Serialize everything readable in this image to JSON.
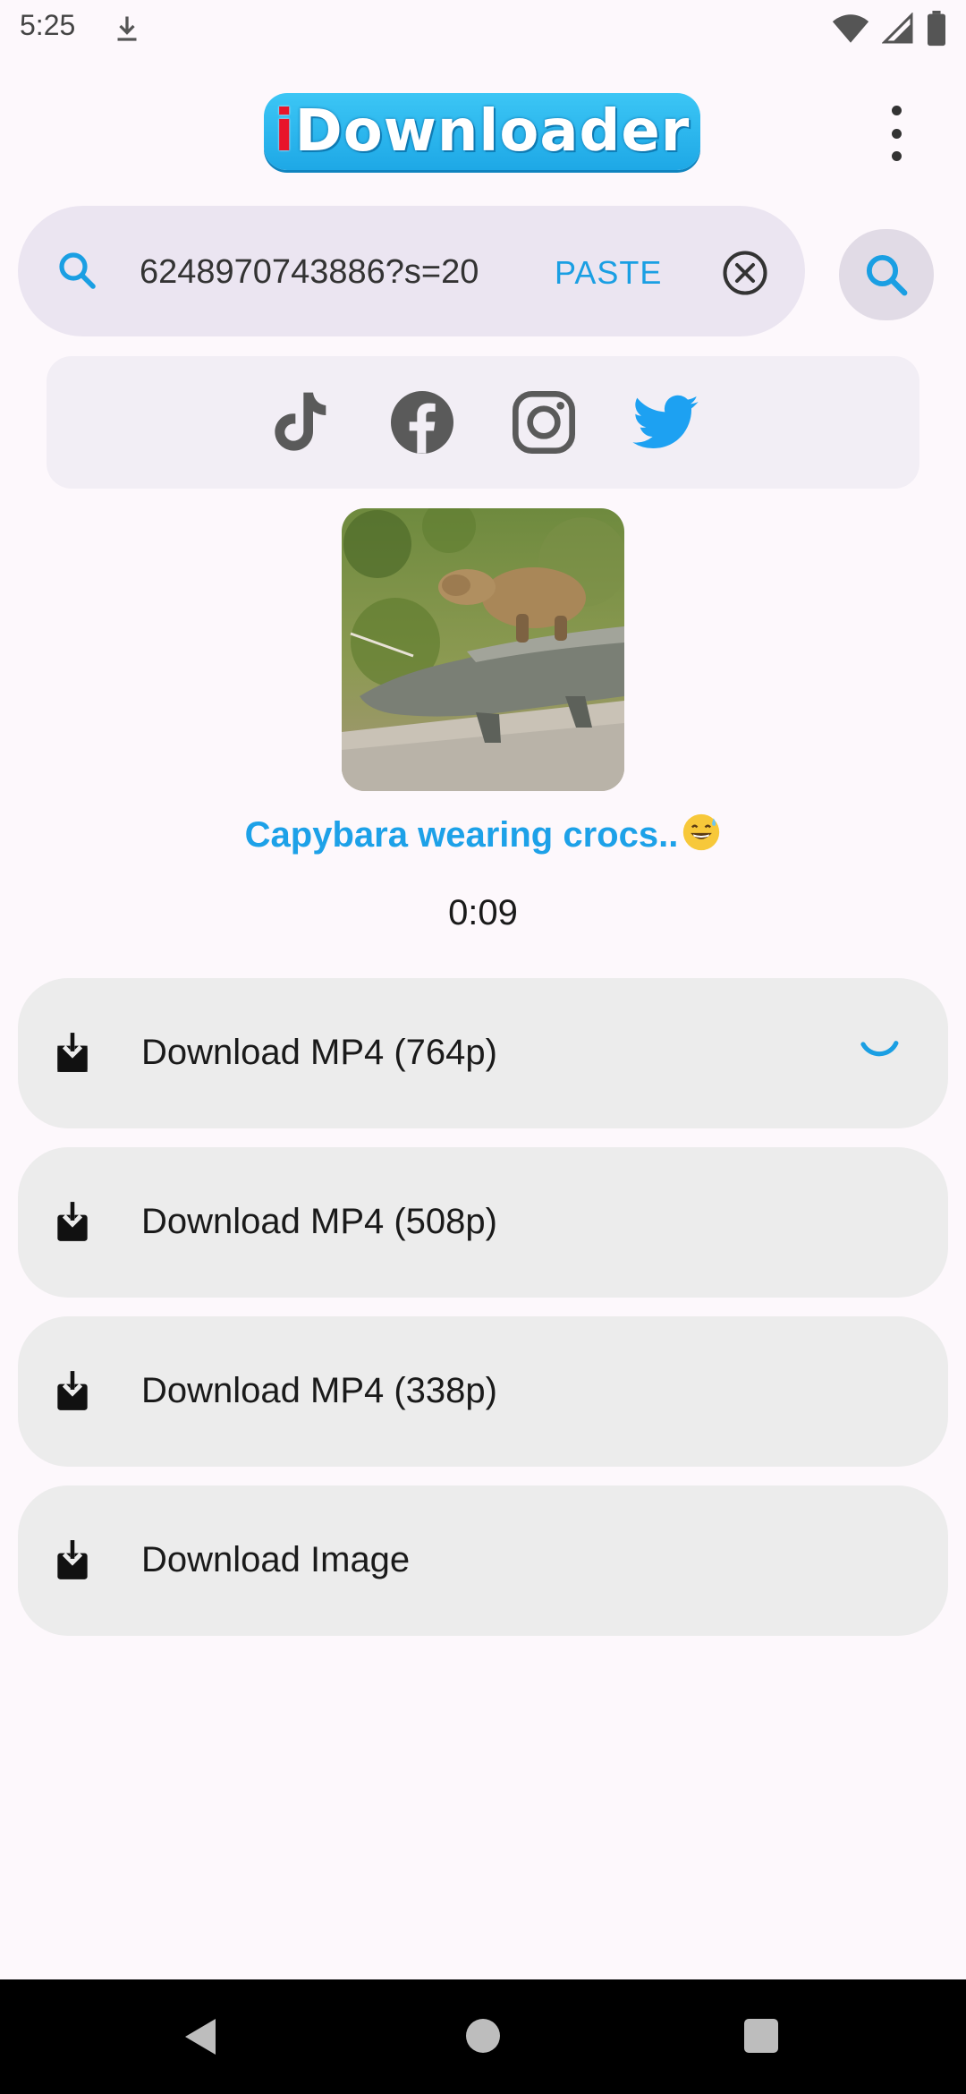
{
  "status_bar": {
    "time": "5:25",
    "icons": [
      "download-icon",
      "wifi-icon",
      "signal-icon",
      "battery-icon"
    ]
  },
  "header": {
    "logo_first_letter": "i",
    "logo_rest": "Downloader",
    "menu_icon": "more-vert-icon"
  },
  "search": {
    "value": "6248970743886?s=20",
    "paste_label": "PASTE",
    "icons": [
      "search-icon",
      "clear-icon",
      "search-button-icon"
    ]
  },
  "platforms": [
    {
      "name": "tiktok",
      "color": "#5a5a5a"
    },
    {
      "name": "facebook",
      "color": "#5a5a5a"
    },
    {
      "name": "instagram",
      "color": "#5a5a5a"
    },
    {
      "name": "twitter",
      "color": "#1da1f2"
    }
  ],
  "media": {
    "title": "Capybara wearing crocs..",
    "duration": "0:09"
  },
  "downloads": [
    {
      "label": "Download MP4 (764p)",
      "loading": true
    },
    {
      "label": "Download MP4 (508p)",
      "loading": false
    },
    {
      "label": "Download MP4 (338p)",
      "loading": false
    },
    {
      "label": "Download Image",
      "loading": false
    }
  ],
  "colors": {
    "accent": "#1da1e8",
    "background": "#fdf8fc",
    "button_bg": "#ececec",
    "search_bg": "#ebe5f1"
  }
}
